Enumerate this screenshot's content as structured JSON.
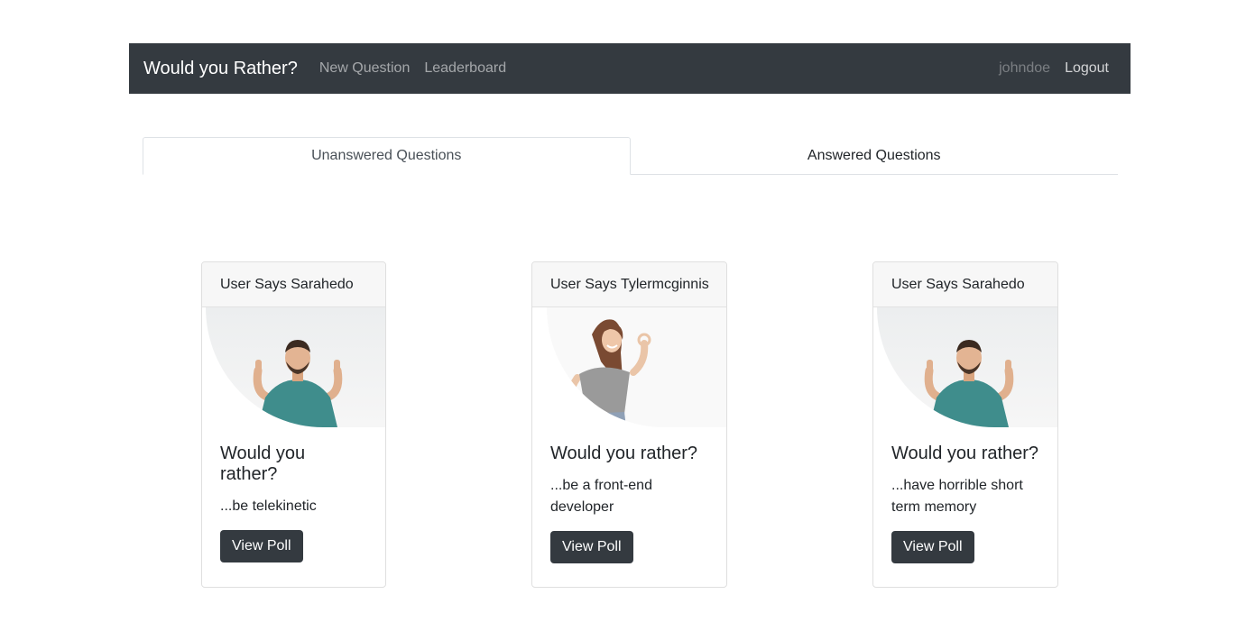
{
  "navbar": {
    "brand": "Would you Rather?",
    "links": [
      "New Question",
      "Leaderboard"
    ],
    "username": "johndoe",
    "logout": "Logout"
  },
  "tabs": [
    {
      "label": "Unanswered Questions",
      "active": true
    },
    {
      "label": "Answered Questions",
      "active": false
    }
  ],
  "cards": [
    {
      "header": "User Says Sarahedo",
      "title": "Would you rather?",
      "text": "...be telekinetic",
      "button": "View Poll",
      "avatar": "man-pointing-up"
    },
    {
      "header": "User Says Tylermcginnis",
      "title": "Would you rather?",
      "text": "...be a front-end developer",
      "button": "View Poll",
      "avatar": "woman-ok-sign"
    },
    {
      "header": "User Says Sarahedo",
      "title": "Would you rather?",
      "text": "...have horrible short term memory",
      "button": "View Poll",
      "avatar": "man-pointing-up"
    }
  ]
}
